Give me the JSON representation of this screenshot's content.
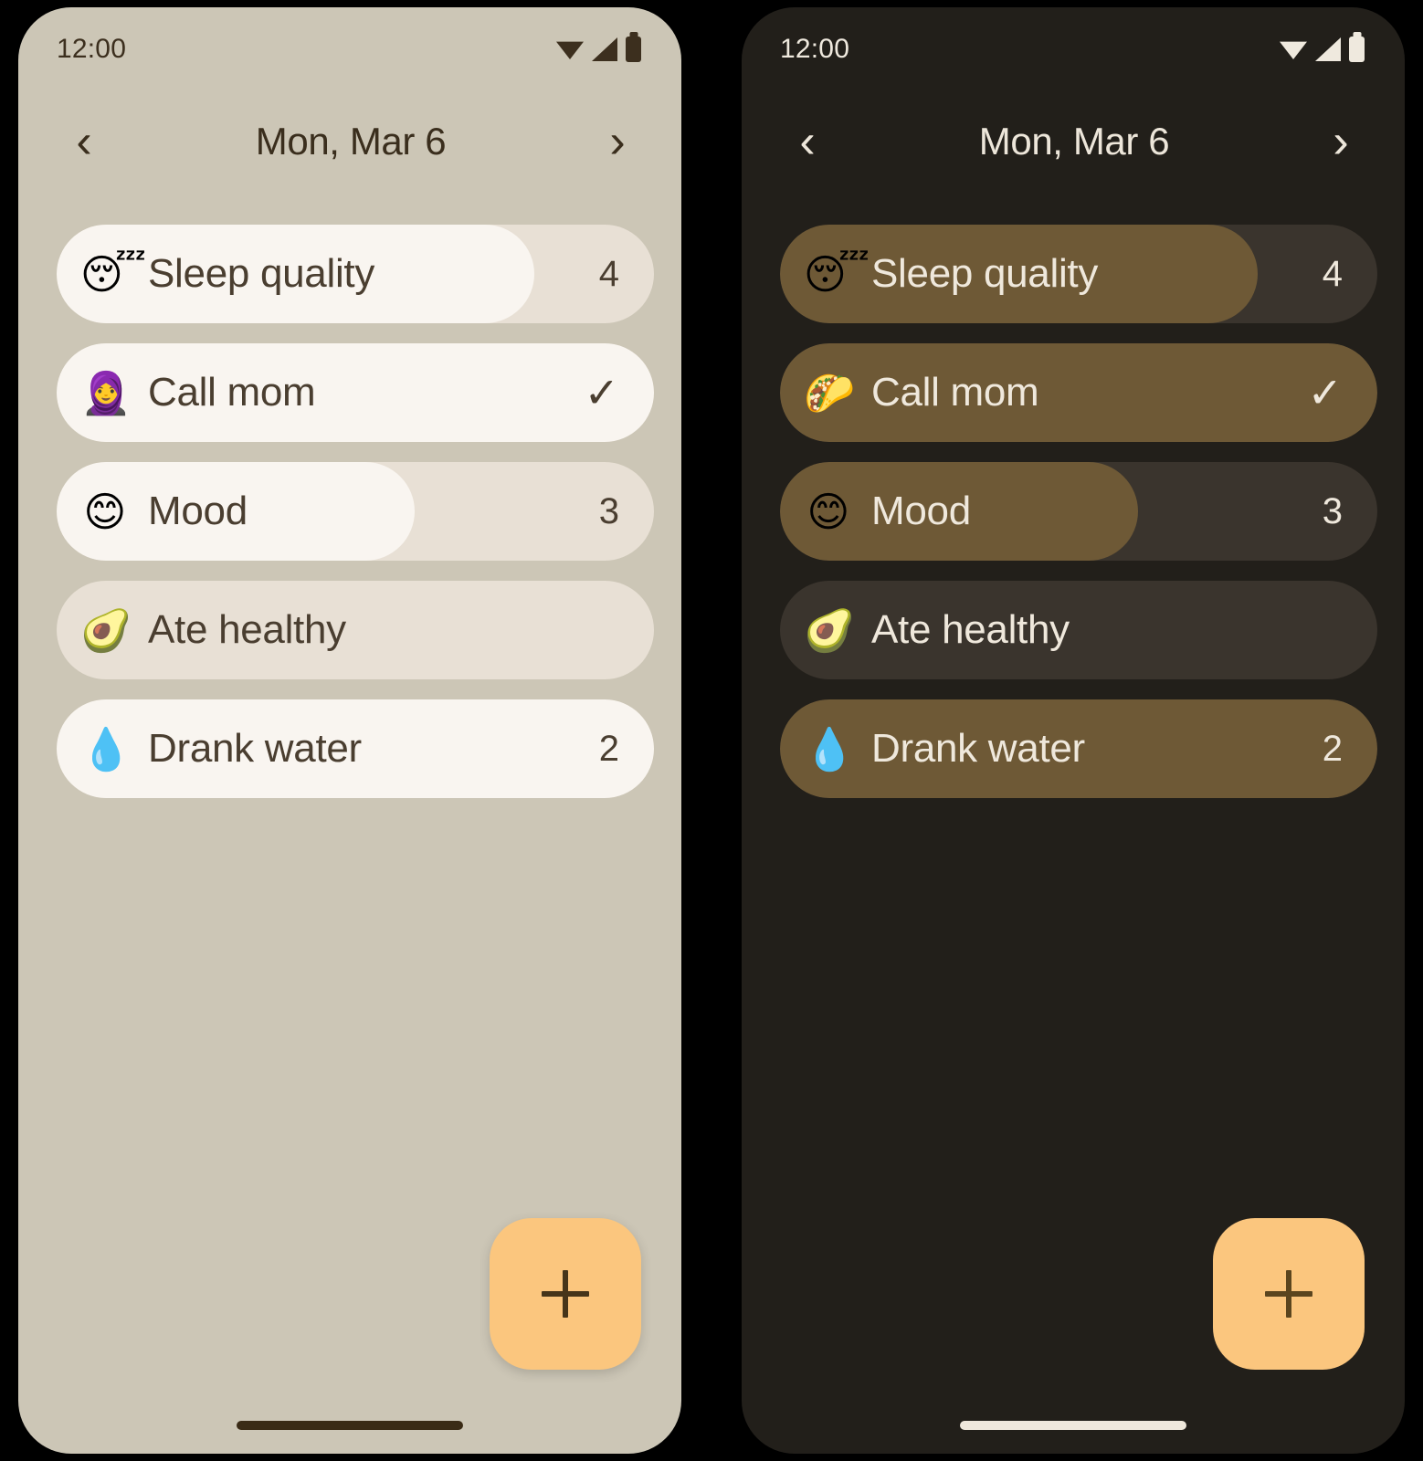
{
  "app": {
    "theme_variants": [
      "light",
      "dark"
    ],
    "accent_color": "#FBC67E"
  },
  "panels": [
    {
      "id": "light-panel",
      "theme": "light",
      "colors": {
        "background": "#CCC6B6",
        "track": "#E8E0D5",
        "fill": "#F9F5F0",
        "text": "#4A3E30",
        "fab": "#FBC67E"
      },
      "status_bar": {
        "time": "12:00",
        "icons": [
          "wifi-icon",
          "signal-icon",
          "battery-icon"
        ]
      },
      "header": {
        "prev_label": "‹",
        "title": "Mon, Mar 6",
        "next_label": "›"
      },
      "habits": [
        {
          "emoji": "😴",
          "emoji_name": "sleeping-face-emoji",
          "label": "Sleep quality",
          "value": "4",
          "progress_pct": 80,
          "completed": false
        },
        {
          "emoji": "🧕",
          "emoji_name": "woman-with-headscarf-emoji",
          "label": "Call mom",
          "value": "✓",
          "progress_pct": 100,
          "completed": true
        },
        {
          "emoji": "😊",
          "emoji_name": "smiling-face-emoji",
          "label": "Mood",
          "value": "3",
          "progress_pct": 60,
          "completed": false
        },
        {
          "emoji": "🥑",
          "emoji_name": "avocado-emoji",
          "label": "Ate healthy",
          "value": "",
          "progress_pct": 0,
          "completed": false
        },
        {
          "emoji": "💧",
          "emoji_name": "droplet-emoji",
          "label": "Drank water",
          "value": "2",
          "progress_pct": 100,
          "completed": false
        }
      ],
      "fab": {
        "label": "+",
        "name": "add-habit-button"
      },
      "gesture_bar": true
    },
    {
      "id": "dark-panel",
      "theme": "dark",
      "colors": {
        "background": "#221F1A",
        "track": "#3A342D",
        "fill": "#6E5936",
        "text": "#EFE8DC",
        "fab": "#FBC67E"
      },
      "status_bar": {
        "time": "12:00",
        "icons": [
          "wifi-icon",
          "signal-icon",
          "battery-icon"
        ]
      },
      "header": {
        "prev_label": "‹",
        "title": "Mon, Mar 6",
        "next_label": "›"
      },
      "habits": [
        {
          "emoji": "😴",
          "emoji_name": "sleeping-face-emoji",
          "label": "Sleep quality",
          "value": "4",
          "progress_pct": 80,
          "completed": false
        },
        {
          "emoji": "🌮",
          "emoji_name": "taco-emoji",
          "label": "Call mom",
          "value": "✓",
          "progress_pct": 100,
          "completed": true
        },
        {
          "emoji": "😊",
          "emoji_name": "smiling-face-emoji",
          "label": "Mood",
          "value": "3",
          "progress_pct": 60,
          "completed": false
        },
        {
          "emoji": "🥑",
          "emoji_name": "avocado-emoji",
          "label": "Ate healthy",
          "value": "",
          "progress_pct": 0,
          "completed": false
        },
        {
          "emoji": "💧",
          "emoji_name": "droplet-emoji",
          "label": "Drank water",
          "value": "2",
          "progress_pct": 100,
          "completed": false
        }
      ],
      "fab": {
        "label": "+",
        "name": "add-habit-button"
      },
      "gesture_bar": true
    }
  ]
}
